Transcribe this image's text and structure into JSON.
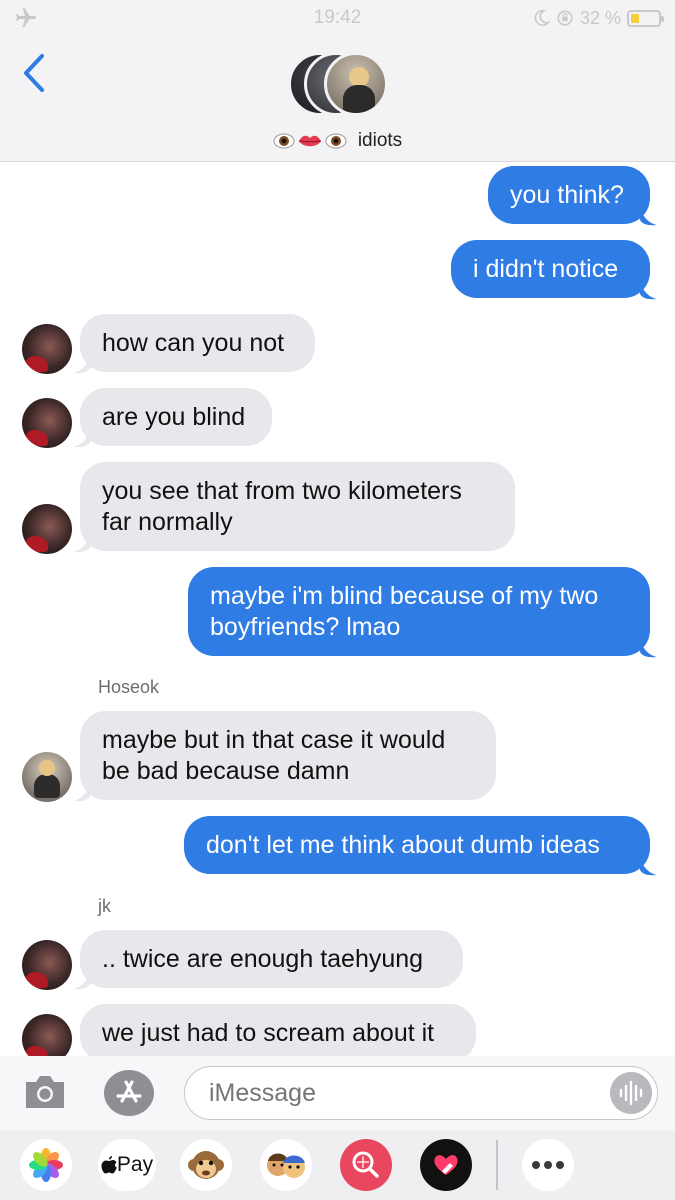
{
  "status_bar": {
    "time": "19:42",
    "battery_text": "32 %",
    "battery_level": 0.32,
    "icons": [
      "airplane-icon",
      "moon-icon",
      "orientation-lock-icon",
      "battery-icon"
    ]
  },
  "header": {
    "group_name": "idiots",
    "name_emojis": [
      "eye-emoji",
      "lips-emoji",
      "eye-emoji"
    ]
  },
  "messages": [
    {
      "direction": "outgoing",
      "text": "you think?"
    },
    {
      "direction": "outgoing",
      "text": "i didn't notice"
    },
    {
      "direction": "incoming",
      "sender_avatar": "taehyung",
      "text": "how can you not"
    },
    {
      "direction": "incoming",
      "sender_avatar": "taehyung",
      "text": "are you blind"
    },
    {
      "direction": "incoming",
      "sender_avatar": "taehyung",
      "text": "you see that from two kilometers far normally"
    },
    {
      "direction": "outgoing",
      "text": "maybe i'm blind because of my two boyfriends? lmao"
    },
    {
      "direction": "incoming",
      "sender": "Hoseok",
      "sender_avatar": "hoseok",
      "text": "maybe but in that case it would be bad because damn"
    },
    {
      "direction": "outgoing",
      "text": "don't let me think about dumb ideas"
    },
    {
      "direction": "incoming",
      "sender": "jk",
      "sender_avatar": "taehyung",
      "text": ".. twice are enough taehyung"
    },
    {
      "direction": "incoming",
      "sender_avatar": "taehyung",
      "text": "we just had to scream about it"
    }
  ],
  "composer": {
    "placeholder": "iMessage"
  },
  "app_drawer": {
    "apps": [
      "photos-icon",
      "apple-pay",
      "animoji-icon",
      "memoji-icon",
      "search-images-icon",
      "heart-digital-touch-icon",
      "more-icon"
    ],
    "apple_pay_label": "Pay"
  },
  "colors": {
    "outgoing_bubble": "#2f7ce4",
    "incoming_bubble": "#e8e8ec",
    "header_bg": "#f3f3f5",
    "accent": "#2f7ce4"
  }
}
